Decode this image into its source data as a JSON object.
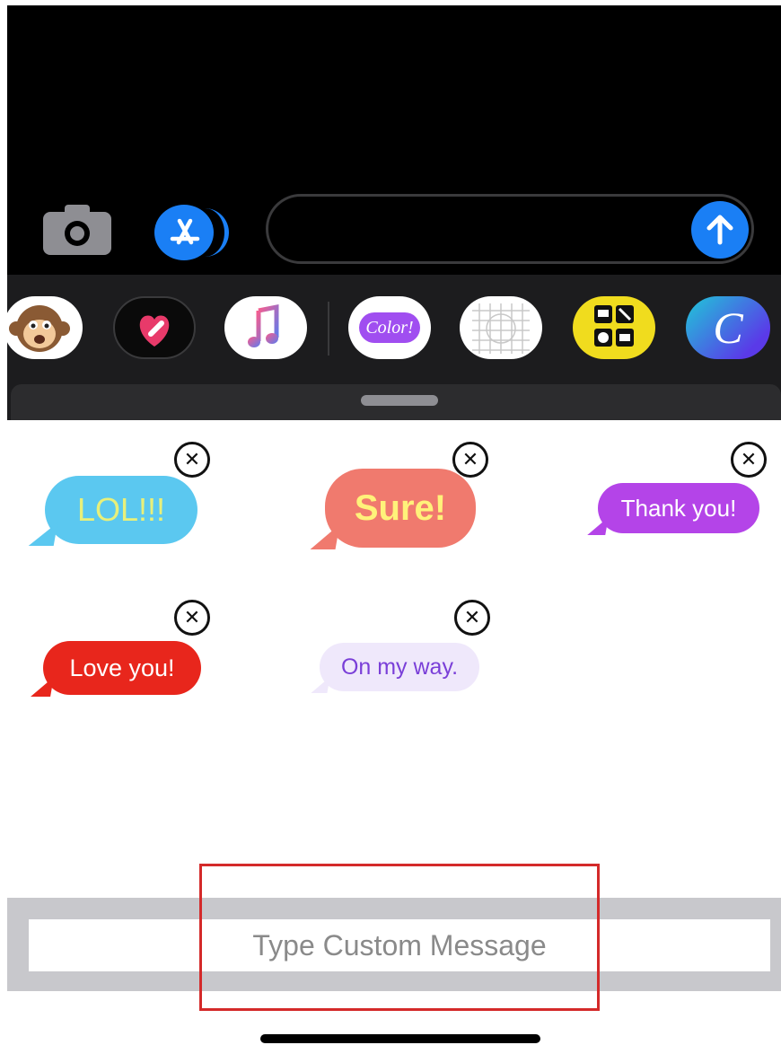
{
  "toolbar": {
    "camera_icon": "camera-icon",
    "appstore_icon": "app-store-icon",
    "send_icon": "arrow-up-icon",
    "message_value": ""
  },
  "apps": [
    {
      "name": "animoji",
      "icon": "monkey-emoji-icon"
    },
    {
      "name": "digital-touch",
      "icon": "heart-icon"
    },
    {
      "name": "music",
      "icon": "music-note-icon"
    },
    {
      "name": "color-text",
      "icon": "color-text-icon",
      "label": "Color!"
    },
    {
      "name": "grid-app",
      "icon": "grid-icon"
    },
    {
      "name": "widget-app",
      "icon": "widget-icon"
    },
    {
      "name": "canva",
      "icon": "canva-icon",
      "label": "C"
    }
  ],
  "stickers": [
    {
      "text": "LOL!!!",
      "bg": "#5bc8f0",
      "color": "#e8f07a"
    },
    {
      "text": "Sure!",
      "bg": "#f07a6e",
      "color": "#fff27a"
    },
    {
      "text": "Thank you!",
      "bg": "#b444e8",
      "color": "#ffffff"
    },
    {
      "text": "Love you!",
      "bg": "#e8261c",
      "color": "#ffffff"
    },
    {
      "text": "On my way.",
      "bg": "#efe8fb",
      "color": "#7a3fd8"
    }
  ],
  "custom_message": {
    "placeholder": "Type Custom Message",
    "value": ""
  },
  "colors": {
    "accent": "#1a7ff5",
    "highlight": "#d42a2a"
  }
}
